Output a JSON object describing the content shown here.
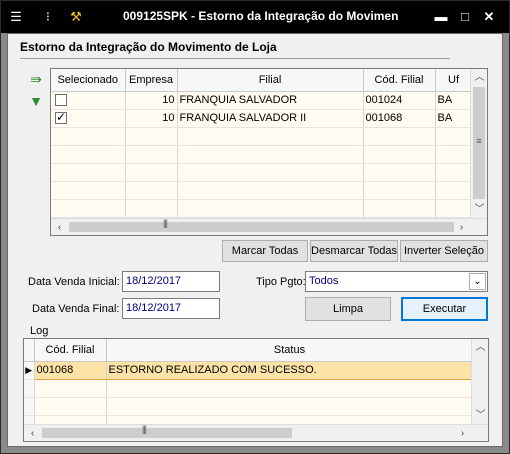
{
  "window": {
    "title": "009125SPK - Estorno da Integração do Movimen",
    "controls": [
      "minimize-icon",
      "maximize-icon",
      "close-icon"
    ]
  },
  "heading": "Estorno da Integração do Movimento de Loja",
  "branches_grid": {
    "columns": [
      "Selecionado",
      "Empresa",
      "Filial",
      "Cód. Filial",
      "Uf"
    ],
    "rows": [
      {
        "selected": false,
        "empresa": "10",
        "filial": "FRANQUIA SALVADOR",
        "cod_filial": "001024",
        "uf": "BA"
      },
      {
        "selected": true,
        "empresa": "10",
        "filial": "FRANQUIA SALVADOR II",
        "cod_filial": "001068",
        "uf": "BA"
      }
    ]
  },
  "buttons": {
    "marcar_todas": "Marcar Todas",
    "desmarcar_todas": "Desmarcar Todas",
    "inverter_selecao": "Inverter Seleção",
    "limpa": "Limpa",
    "executar": "Executar"
  },
  "form": {
    "data_venda_inicial_label": "Data Venda Inicial:",
    "data_venda_inicial": "18/12/2017",
    "data_venda_final_label": "Data Venda Final:",
    "data_venda_final": "18/12/2017",
    "tipo_pgto_label": "Tipo Pgto:",
    "tipo_pgto": "Todos"
  },
  "log": {
    "label": "Log",
    "columns": [
      "Cód. Filial",
      "Status"
    ],
    "rows": [
      {
        "cod_filial": "001068",
        "status": "ESTORNO REALIZADO COM SUCESSO."
      }
    ]
  },
  "colors": {
    "titlebar": "#000000",
    "row_background": "#fffbf0",
    "selected_row": "#fbe3a8",
    "focus_border": "#0078d7"
  }
}
